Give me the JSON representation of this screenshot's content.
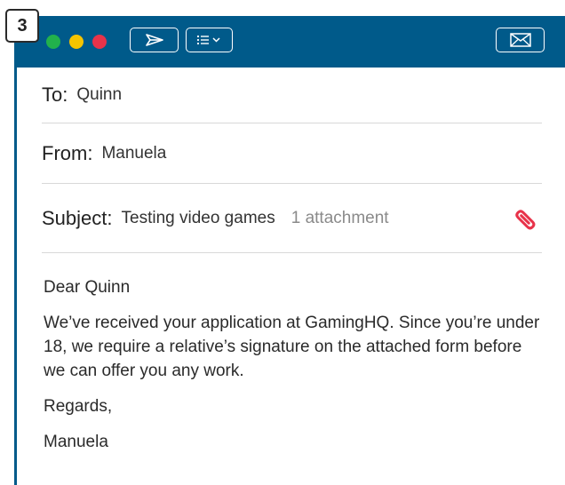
{
  "badge": {
    "number": "3"
  },
  "colors": {
    "titlebar": "#005a8a",
    "dot_green": "#22b14c",
    "dot_yellow": "#f5c400",
    "dot_red": "#e8334a",
    "attachment_accent": "#e8334a",
    "attachment_text": "#8a8a8a"
  },
  "toolbar": {
    "traffic_lights": [
      "green",
      "yellow",
      "red"
    ],
    "send_icon": "send-icon",
    "list_icon": "list-menu-icon",
    "mail_icon": "envelope-icon"
  },
  "email": {
    "to_label": "To:",
    "to_value": "Quinn",
    "from_label": "From:",
    "from_value": "Manuela",
    "subject_label": "Subject:",
    "subject_value": "Testing video games",
    "attachment_text": "1 attachment",
    "attachment_icon": "paperclip-icon",
    "body": [
      "Dear Quinn",
      "We’ve received your application at GamingHQ. Since you’re under 18, we require a relative’s signature on the attached form before we can offer you any work.",
      "Regards,",
      "Manuela"
    ]
  }
}
